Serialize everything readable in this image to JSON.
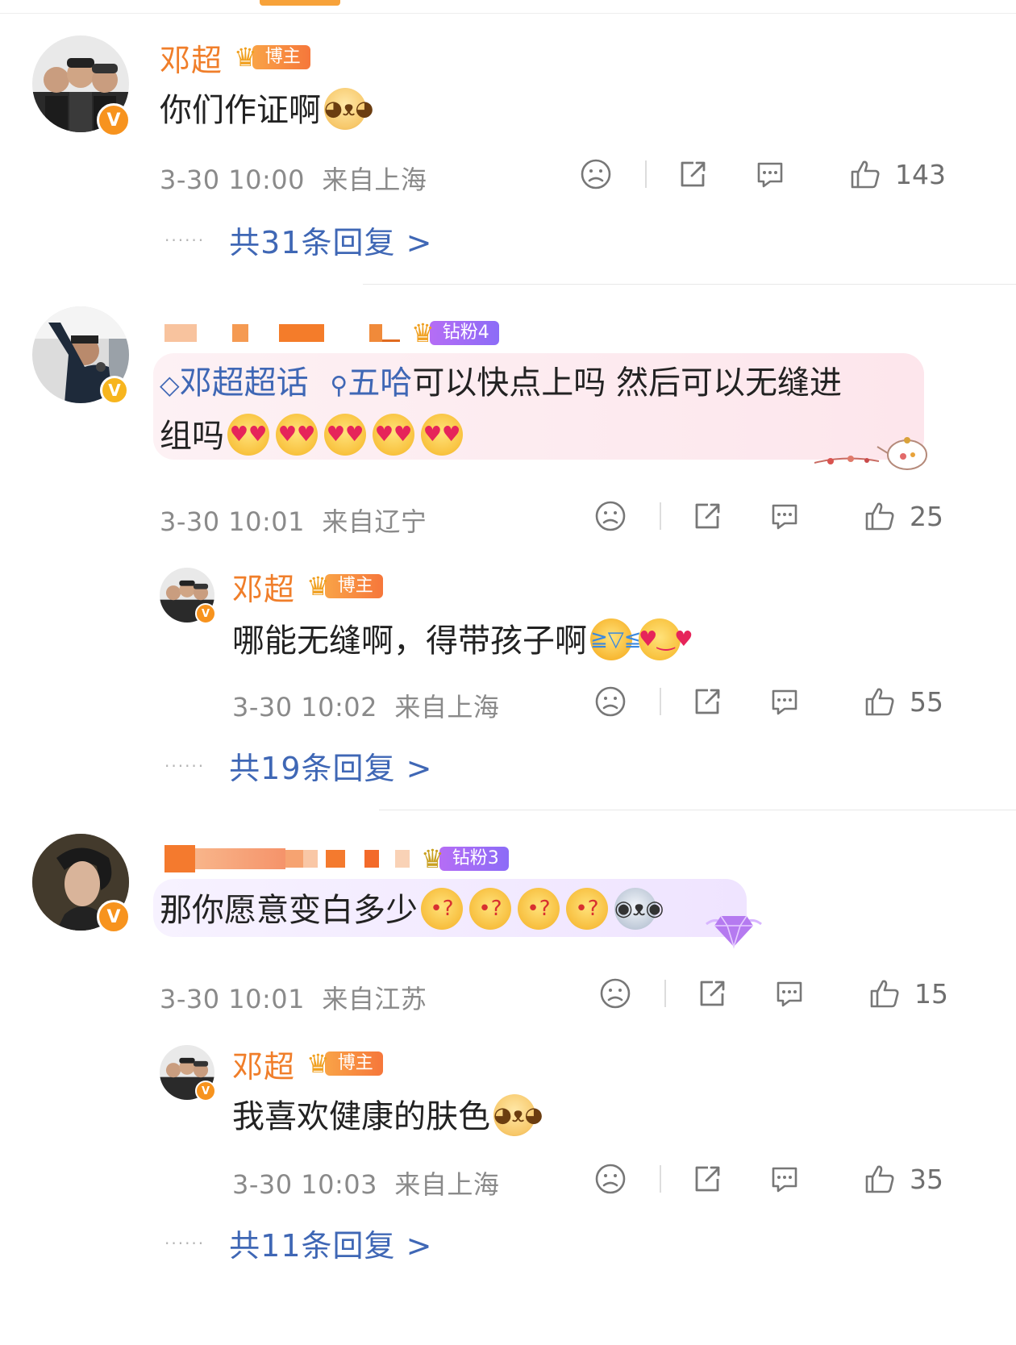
{
  "badges": {
    "blogger": "博主",
    "fan4": "钻粉4",
    "fan3": "钻粉3"
  },
  "comments": [
    {
      "user": "邓超",
      "text": "你们作证啊",
      "time": "3-30 10:00",
      "location": "来自上海",
      "likes": "143",
      "replies": "共31条回复 >"
    },
    {
      "topic": "邓超超话",
      "search_tag": "五哈",
      "text_line1": "可以快点上吗 然后可以无缝进",
      "text_line2": "组吗",
      "time": "3-30 10:01",
      "location": "来自辽宁",
      "likes": "25",
      "reply": {
        "user": "邓超",
        "text": "哪能无缝啊，得带孩子啊",
        "time": "3-30 10:02",
        "location": "来自上海",
        "likes": "55"
      },
      "replies": "共19条回复 >"
    },
    {
      "text": "那你愿意变白多少",
      "time": "3-30 10:01",
      "location": "来自江苏",
      "likes": "15",
      "reply": {
        "user": "邓超",
        "text": "我喜欢健康的肤色",
        "time": "3-30 10:03",
        "location": "来自上海",
        "likes": "35"
      },
      "replies": "共11条回复 >"
    }
  ],
  "icons": [
    "dislike-icon",
    "share-icon",
    "comment-icon",
    "like-icon",
    "verified-icon",
    "crown-icon",
    "diamond-icon",
    "search-icon"
  ],
  "colors": {
    "accent": "#f07e2a",
    "link": "#3f67b5",
    "badge_orange": "#f6773b",
    "badge_purple": "#8c6cf7"
  }
}
